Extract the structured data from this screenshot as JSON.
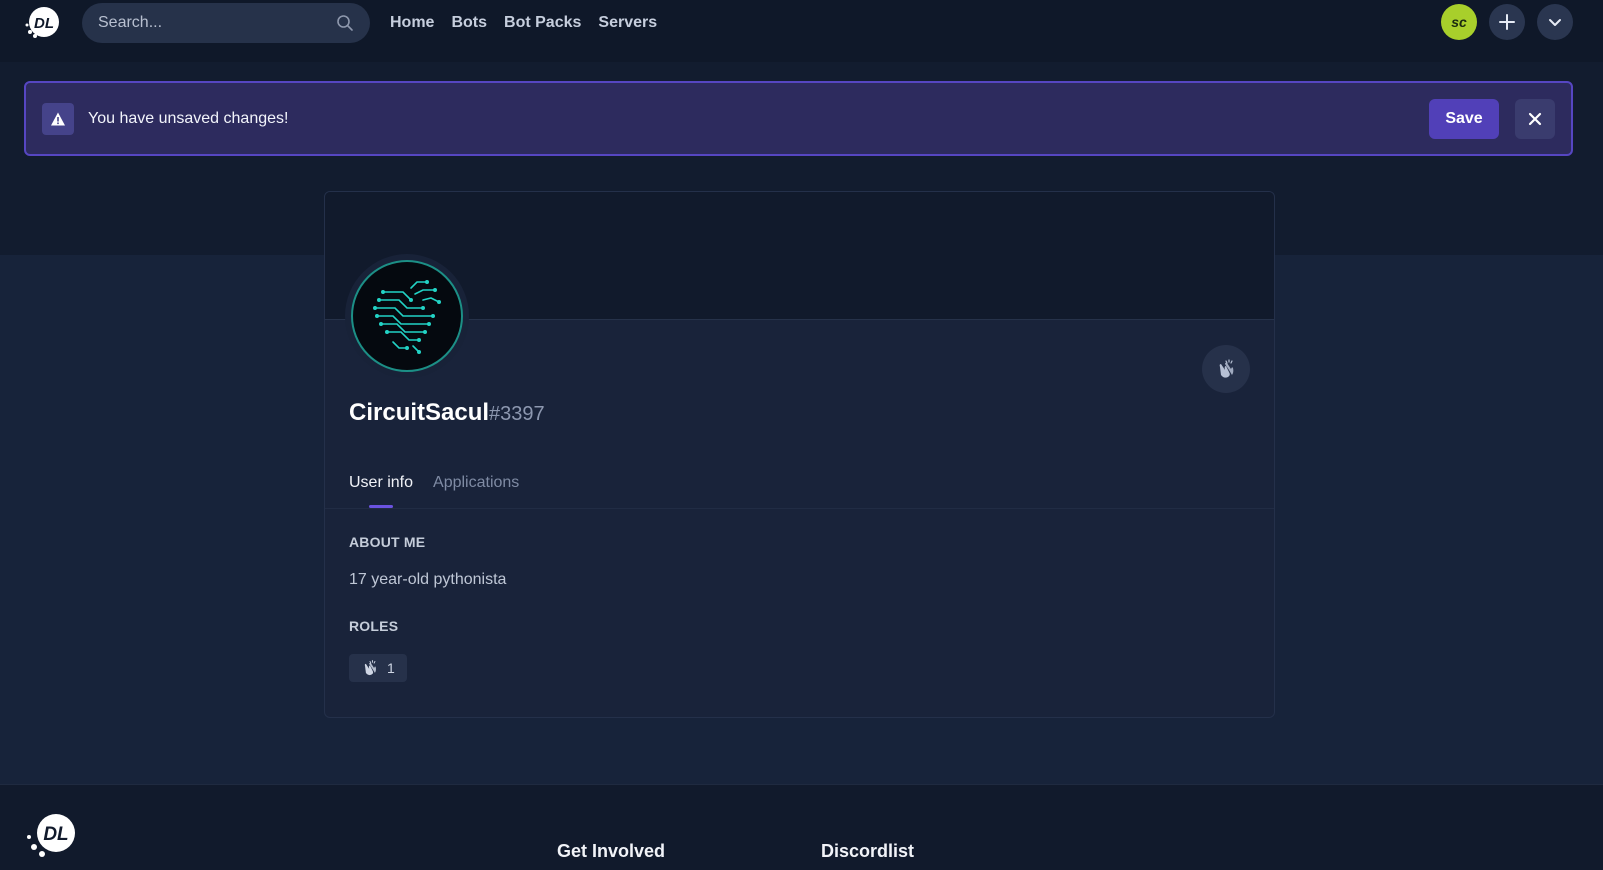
{
  "navbar": {
    "logo_text": "DL",
    "search_placeholder": "Search...",
    "links": [
      "Home",
      "Bots",
      "Bot Packs",
      "Servers"
    ],
    "user_avatar_initials": "sc"
  },
  "banner": {
    "message": "You have unsaved changes!",
    "save_label": "Save"
  },
  "profile": {
    "username": "CircuitSacul",
    "discriminator": "#3397",
    "tabs": [
      "User info",
      "Applications"
    ],
    "active_tab": "User info",
    "about_heading": "ABOUT ME",
    "about_text": "17 year-old pythonista",
    "roles_heading": "ROLES",
    "role_count": "1"
  },
  "footer": {
    "headings": [
      "Get Involved",
      "Discordlist"
    ]
  },
  "colors": {
    "accent": "#5140b8",
    "banner_border": "#5646c2",
    "avatar_green": "#a8cf2b",
    "circuit_teal": "#22d3c5"
  }
}
